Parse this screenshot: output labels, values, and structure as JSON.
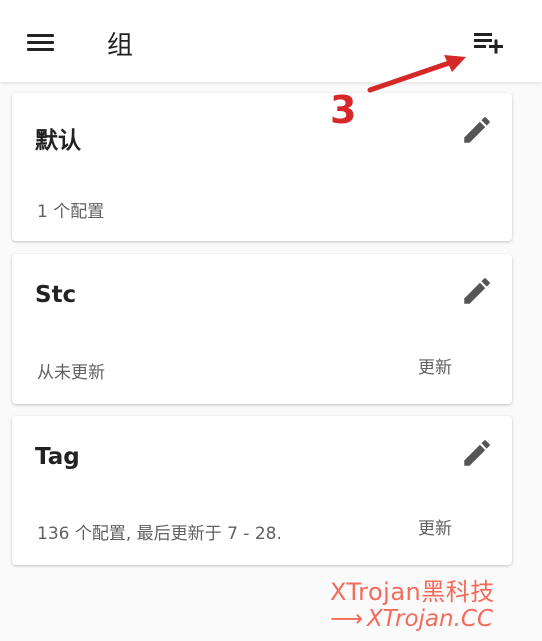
{
  "appbar": {
    "title": "组"
  },
  "groups": [
    {
      "name": "默认",
      "subtitle": "1 个配置",
      "update_label": ""
    },
    {
      "name": "Stc",
      "subtitle": "从未更新",
      "update_label": "更新"
    },
    {
      "name": "Tag",
      "subtitle": "136 个配置, 最后更新于 7 - 28.",
      "update_label": "更新"
    }
  ],
  "annotation": {
    "step_number": "3",
    "color": "#d62828"
  },
  "watermark": {
    "line1": "XTrojan黑科技",
    "line2_arrow": "⟶",
    "line2": "XTrojan.CC",
    "color": "#f26b5b"
  },
  "icons": {
    "menu": "hamburger-menu-icon",
    "add": "playlist-add-icon",
    "edit": "pencil-icon"
  }
}
